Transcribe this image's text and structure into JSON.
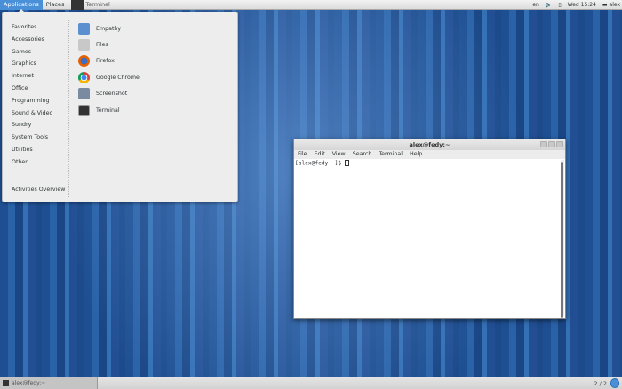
{
  "topbar": {
    "applications": "Applications",
    "places": "Places",
    "active_app": "Terminal",
    "lang": "en",
    "clock": "Wed 15:24",
    "user": "alex"
  },
  "menu": {
    "categories": [
      "Favorites",
      "Accessories",
      "Games",
      "Graphics",
      "Internet",
      "Office",
      "Programming",
      "Sound & Video",
      "Sundry",
      "System Tools",
      "Utilities",
      "Other"
    ],
    "activities": "Activities Overview",
    "apps": [
      {
        "label": "Empathy",
        "color": "#5b8fd0"
      },
      {
        "label": "Files",
        "color": "#c8c8c8"
      },
      {
        "label": "Firefox",
        "color": "#e66000"
      },
      {
        "label": "Google Chrome",
        "color": "#4caf50"
      },
      {
        "label": "Screenshot",
        "color": "#7a8aa0"
      },
      {
        "label": "Terminal",
        "color": "#333333"
      }
    ]
  },
  "terminal": {
    "title": "alex@fedy:~",
    "menu": [
      "File",
      "Edit",
      "View",
      "Search",
      "Terminal",
      "Help"
    ],
    "prompt": "[alex@fedy ~]$ "
  },
  "bottombar": {
    "task": "alex@fedy:~",
    "workspace": "2 / 2"
  }
}
